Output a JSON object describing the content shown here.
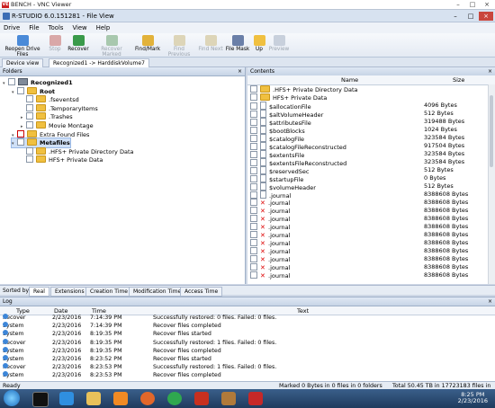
{
  "vnc": {
    "title": "BENCH - VNC Viewer",
    "icon": "VE"
  },
  "app": {
    "title": "R-STUDIO 6.0.151281 - File View"
  },
  "menu": [
    "Drive",
    "File",
    "Tools",
    "View",
    "Help"
  ],
  "toolbar": [
    {
      "label": "Reopen Drive Files",
      "icon": "reopen-icon",
      "enabled": true
    },
    {
      "label": "Stop",
      "icon": "stop-icon",
      "enabled": false
    },
    {
      "label": "Recover",
      "icon": "recover-icon",
      "enabled": true
    },
    {
      "label": "Recover Marked",
      "icon": "recover-marked-icon",
      "enabled": false
    },
    {
      "label": "Find/Mark",
      "icon": "find-mark-icon",
      "enabled": true
    },
    {
      "label": "Find Previous",
      "icon": "find-previous-icon",
      "enabled": false
    },
    {
      "label": "Find Next",
      "icon": "find-next-icon",
      "enabled": false
    },
    {
      "label": "File Mask",
      "icon": "file-mask-icon",
      "enabled": true
    },
    {
      "label": "Up",
      "icon": "up-icon",
      "enabled": true
    },
    {
      "label": "Preview",
      "icon": "preview-icon",
      "enabled": false
    }
  ],
  "tabs": {
    "device_view": "Device view",
    "current": "Recognized1 -> HarddiskVolume7"
  },
  "folders": {
    "title": "Folders",
    "close": "×",
    "tree": [
      {
        "label": "Recognized1",
        "level": 0,
        "type": "drive",
        "bold": true
      },
      {
        "label": "Root",
        "level": 1,
        "type": "folder",
        "bold": true
      },
      {
        "label": ".fseventsd",
        "level": 2,
        "type": "folder"
      },
      {
        "label": ".TemporaryItems",
        "level": 2,
        "type": "folder"
      },
      {
        "label": ".Trashes",
        "level": 2,
        "type": "folder"
      },
      {
        "label": "Movie Montage",
        "level": 2,
        "type": "folder"
      },
      {
        "label": "Extra Found Files",
        "level": 1,
        "type": "folder",
        "red": true
      },
      {
        "label": "Metafiles",
        "level": 1,
        "type": "folder",
        "bold": true,
        "selected": true
      },
      {
        "label": ".HFS+ Private Directory Data",
        "level": 2,
        "type": "folder"
      },
      {
        "label": "HFS+ Private Data",
        "level": 2,
        "type": "folder"
      }
    ]
  },
  "contents": {
    "title": "Contents",
    "close": "×",
    "columns": {
      "name": "Name",
      "size": "Size"
    },
    "rows": [
      {
        "name": ".HFS+ Private Directory Data",
        "size": "",
        "type": "folder"
      },
      {
        "name": "HFS+ Private Data",
        "size": "",
        "type": "folder"
      },
      {
        "name": "$allocationFile",
        "size": "4096 Bytes",
        "type": "file"
      },
      {
        "name": "$altVolumeHeader",
        "size": "512 Bytes",
        "type": "file"
      },
      {
        "name": "$attributesFile",
        "size": "319488 Bytes",
        "type": "file"
      },
      {
        "name": "$bootBlocks",
        "size": "1024 Bytes",
        "type": "file"
      },
      {
        "name": "$catalogFile",
        "size": "323584 Bytes",
        "type": "file"
      },
      {
        "name": "$catalogFileReconstructed",
        "size": "917504 Bytes",
        "type": "file"
      },
      {
        "name": "$extentsFile",
        "size": "323584 Bytes",
        "type": "file"
      },
      {
        "name": "$extentsFileReconstructed",
        "size": "323584 Bytes",
        "type": "file"
      },
      {
        "name": "$reservedSec",
        "size": "512 Bytes",
        "type": "file"
      },
      {
        "name": "$startupFile",
        "size": "0 Bytes",
        "type": "file"
      },
      {
        "name": "$volumeHeader",
        "size": "512 Bytes",
        "type": "file"
      },
      {
        "name": ".journal",
        "size": "8388608 Bytes",
        "type": "file"
      },
      {
        "name": ".journal",
        "size": "8388608 Bytes",
        "type": "deleted"
      },
      {
        "name": ".journal",
        "size": "8388608 Bytes",
        "type": "deleted"
      },
      {
        "name": ".journal",
        "size": "8388608 Bytes",
        "type": "deleted"
      },
      {
        "name": ".journal",
        "size": "8388608 Bytes",
        "type": "deleted"
      },
      {
        "name": ".journal",
        "size": "8388608 Bytes",
        "type": "deleted"
      },
      {
        "name": ".journal",
        "size": "8388608 Bytes",
        "type": "deleted"
      },
      {
        "name": ".journal",
        "size": "8388608 Bytes",
        "type": "deleted"
      },
      {
        "name": ".journal",
        "size": "8388608 Bytes",
        "type": "deleted"
      },
      {
        "name": ".journal",
        "size": "8388608 Bytes",
        "type": "deleted"
      },
      {
        "name": ".journal",
        "size": "8388608 Bytes",
        "type": "deleted"
      }
    ]
  },
  "sortbar": {
    "label": "Sorted by:",
    "tabs": [
      "Real",
      "Extensions",
      "Creation Time",
      "Modification Time",
      "Access Time"
    ]
  },
  "log": {
    "title": "Log",
    "close": "×",
    "columns": {
      "type": "Type",
      "date": "Date",
      "time": "Time",
      "text": "Text"
    },
    "rows": [
      {
        "type": "Recover",
        "date": "2/23/2016",
        "time": "7:14:39 PM",
        "text": "Successfully restored: 0 files. Failed: 0 files."
      },
      {
        "type": "System",
        "date": "2/23/2016",
        "time": "7:14:39 PM",
        "text": "Recover files completed"
      },
      {
        "type": "System",
        "date": "2/23/2016",
        "time": "8:19:35 PM",
        "text": "Recover files started"
      },
      {
        "type": "Recover",
        "date": "2/23/2016",
        "time": "8:19:35 PM",
        "text": "Successfully restored: 1 files. Failed: 0 files."
      },
      {
        "type": "System",
        "date": "2/23/2016",
        "time": "8:19:35 PM",
        "text": "Recover files completed"
      },
      {
        "type": "System",
        "date": "2/23/2016",
        "time": "8:23:52 PM",
        "text": "Recover files started"
      },
      {
        "type": "Recover",
        "date": "2/23/2016",
        "time": "8:23:53 PM",
        "text": "Successfully restored: 1 files. Failed: 0 files."
      },
      {
        "type": "System",
        "date": "2/23/2016",
        "time": "8:23:53 PM",
        "text": "Recover files completed"
      }
    ]
  },
  "status": {
    "left": "Ready",
    "marked": "Marked 0 Bytes in 0 files in 0 folders",
    "total": "Total 50.45 TB in 17723183 files in 192 folders"
  },
  "taskbar": {
    "time": "8:25 PM",
    "date": "2/23/2016",
    "icons": [
      "start-orb-icon",
      "cmd-icon",
      "ie-icon",
      "explorer-icon",
      "media-player-icon",
      "firefox-icon",
      "chrome-icon",
      "filezilla-icon",
      "r-studio-icon",
      "pdf-icon"
    ]
  },
  "colors": {
    "accent": "#3b6db5",
    "deleted": "#dd0000",
    "selection": "#cfe0f7"
  }
}
